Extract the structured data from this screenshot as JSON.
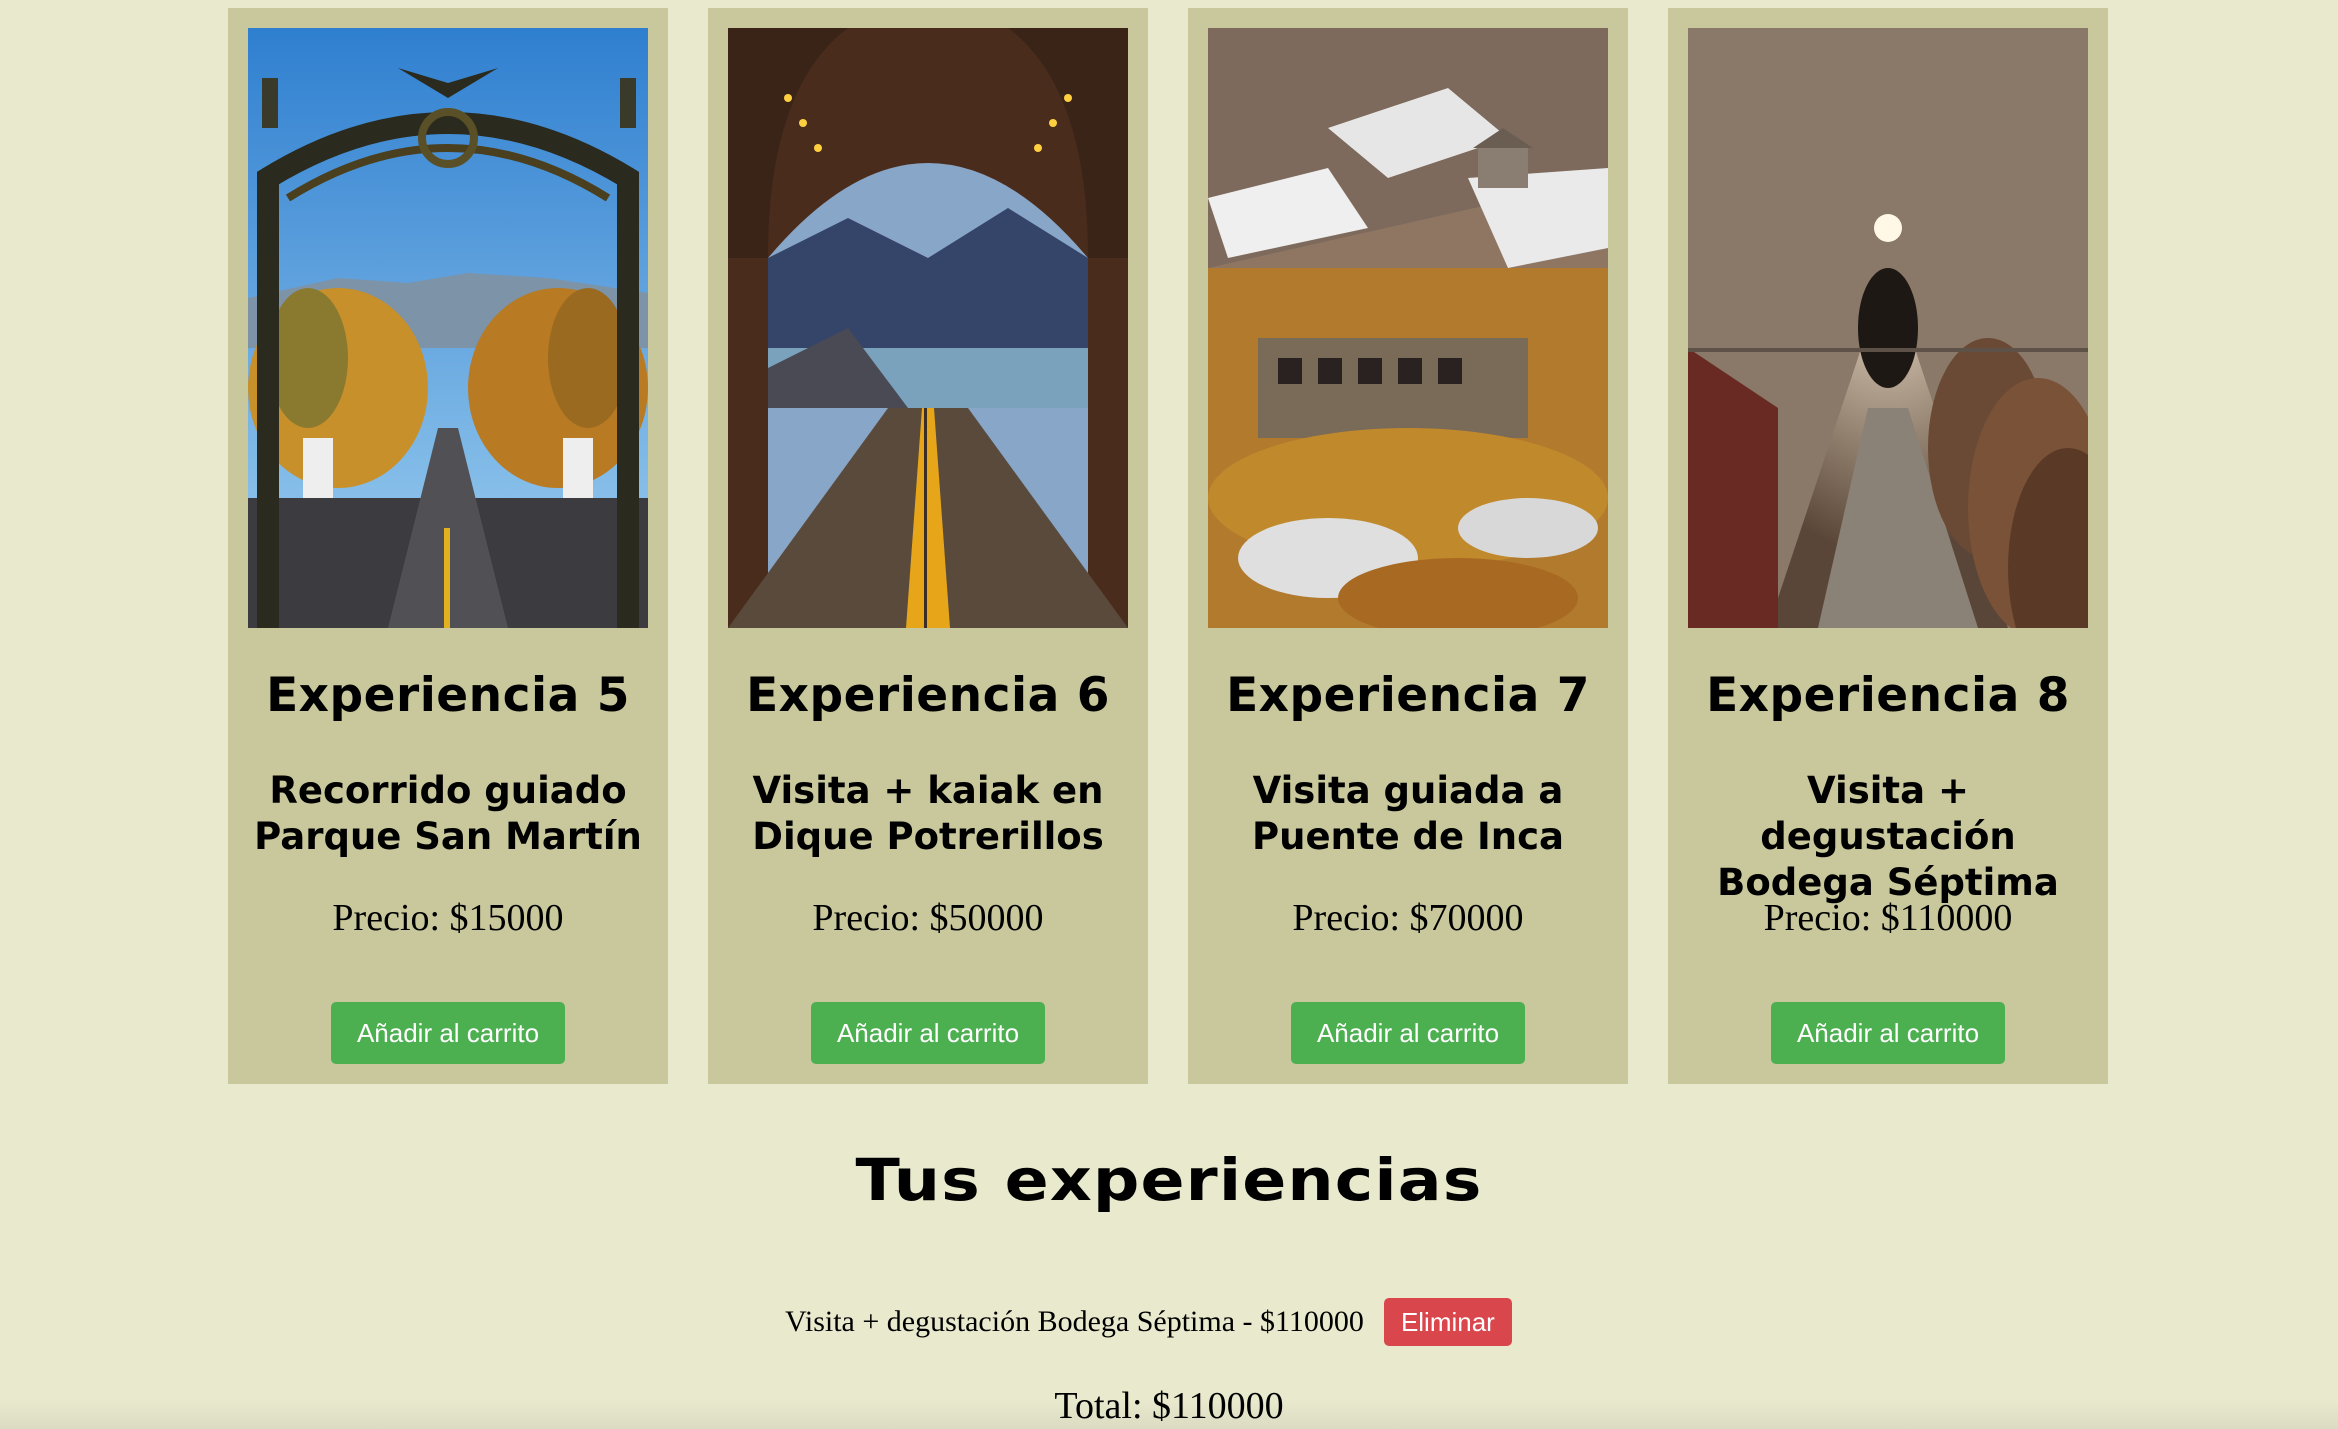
{
  "experiences": [
    {
      "title": "Experiencia 5",
      "description": "Recorrido guiado Parque San Martín",
      "price": "Precio: $15000",
      "button_label": "Añadir al carrito",
      "image_icon": "park-gate-photo"
    },
    {
      "title": "Experiencia 6",
      "description": "Visita + kaiak en Dique Potrerillos",
      "price": "Precio: $50000",
      "button_label": "Añadir al carrito",
      "image_icon": "tunnel-lake-photo"
    },
    {
      "title": "Experiencia 7",
      "description": "Visita guiada a Puente de Inca",
      "price": "Precio: $70000",
      "button_label": "Añadir al carrito",
      "image_icon": "inca-bridge-photo"
    },
    {
      "title": "Experiencia 8",
      "description": "Visita + degustación Bodega Séptima",
      "price": "Precio: $110000",
      "button_label": "Añadir al carrito",
      "image_icon": "wine-cellar-photo"
    }
  ],
  "cart": {
    "title": "Tus experiencias",
    "items": [
      {
        "text": "Visita + degustación Bodega Séptima - $110000",
        "remove_label": "Eliminar"
      }
    ],
    "total": "Total: $110000"
  },
  "colors": {
    "page_background": "#e9e9ce",
    "card_background": "#c8c89c",
    "add_button": "#4caf50",
    "remove_button": "#d9464c"
  }
}
